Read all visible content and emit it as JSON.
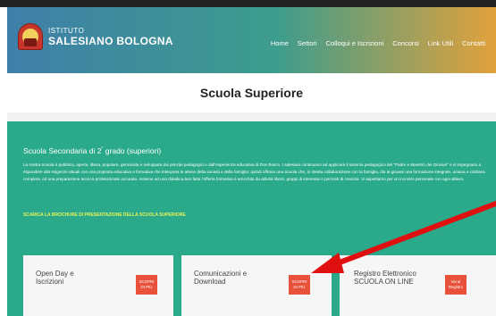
{
  "header": {
    "logo_small": "ISTITUTO",
    "logo_big": "SALESIANO BOLOGNA",
    "nav": [
      "Home",
      "Settori",
      "Colloqui e Iscrizioni",
      "Concorsi",
      "Link Utili",
      "Contatti"
    ]
  },
  "page": {
    "title": "Scuola Superiore"
  },
  "section": {
    "heading_main": "Scuola Secondaria di 2",
    "heading_sup": "°",
    "heading_rest": " grado (superiori)",
    "paragraph": "La nostra Scuola è pubblica, aperta, libera, popolare, germinata e sviluppata dai principi pedagogici e dall'esperienza educativa di Don Bosco. I salesiani continuano ad applicare il sistema pedagogico del \"Padre e Maestro dei Giovani\" e si impegnano a rispondere alle esigenze attuali con una proposta educativa e formativa che interpreta le attese della società e della famiglia: quindi offrono una Scuola che, in stretta collaborazione con la famiglia, dia ai giovani una formazione integrale, umana e cristiana completa, ed una preparazione tecnico-professionale accurata. Insieme ad una didattica ben fatta l'offerta formativa è arricchita da attività libere, gruppi di interesse e percorsi di crescita. Vi aspettiamo per un incontro personale con ogni allievo.",
    "brochure_link": "SCARICA LA BROCHURE DI PRESENTAZIONE DELLA SCUOLA SUPERIORE"
  },
  "cards": [
    {
      "label_line1": "Open Day e",
      "label_line2": "Iscrizioni",
      "button": "SCOPRI DI PIÙ"
    },
    {
      "label_line1": "Comunicazioni e",
      "label_line2": "Download",
      "button": "SCOPRI DI PIÙ"
    },
    {
      "label_line1": "Registro Elettronico",
      "label_line2": "SCUOLA ON LINE",
      "button": "Vai al Registro"
    }
  ],
  "colors": {
    "teal": "#2aaa8a",
    "button": "#e8523b",
    "arrow": "#e01010"
  }
}
